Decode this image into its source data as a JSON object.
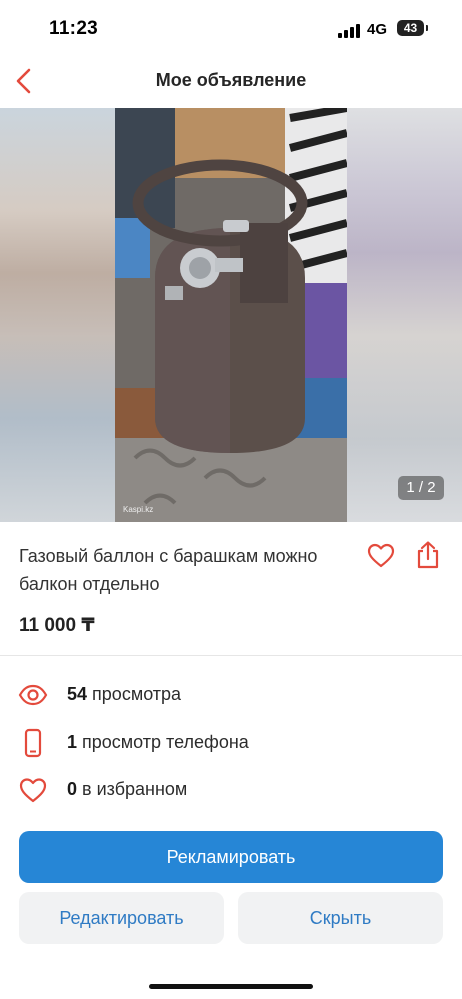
{
  "status_bar": {
    "time": "11:23",
    "network": "4G",
    "battery": "43"
  },
  "nav": {
    "title": "Мое объявление"
  },
  "gallery": {
    "counter": "1 / 2",
    "watermark": "Kaspi.kz"
  },
  "listing": {
    "title": "Газовый баллон с барашкам можно балкон отдельно",
    "price": "11 000 ₸"
  },
  "stats": [
    {
      "icon": "eye-icon",
      "count": "54",
      "label": "просмотра"
    },
    {
      "icon": "phone-icon",
      "count": "1",
      "label": "просмотр телефона"
    },
    {
      "icon": "heart-icon",
      "count": "0",
      "label": "в избранном"
    }
  ],
  "actions": {
    "promote": "Рекламировать",
    "edit": "Редактировать",
    "hide": "Скрыть"
  },
  "colors": {
    "accent": "#e34a3c",
    "primary": "#2686d6",
    "link": "#2f7bc4"
  }
}
